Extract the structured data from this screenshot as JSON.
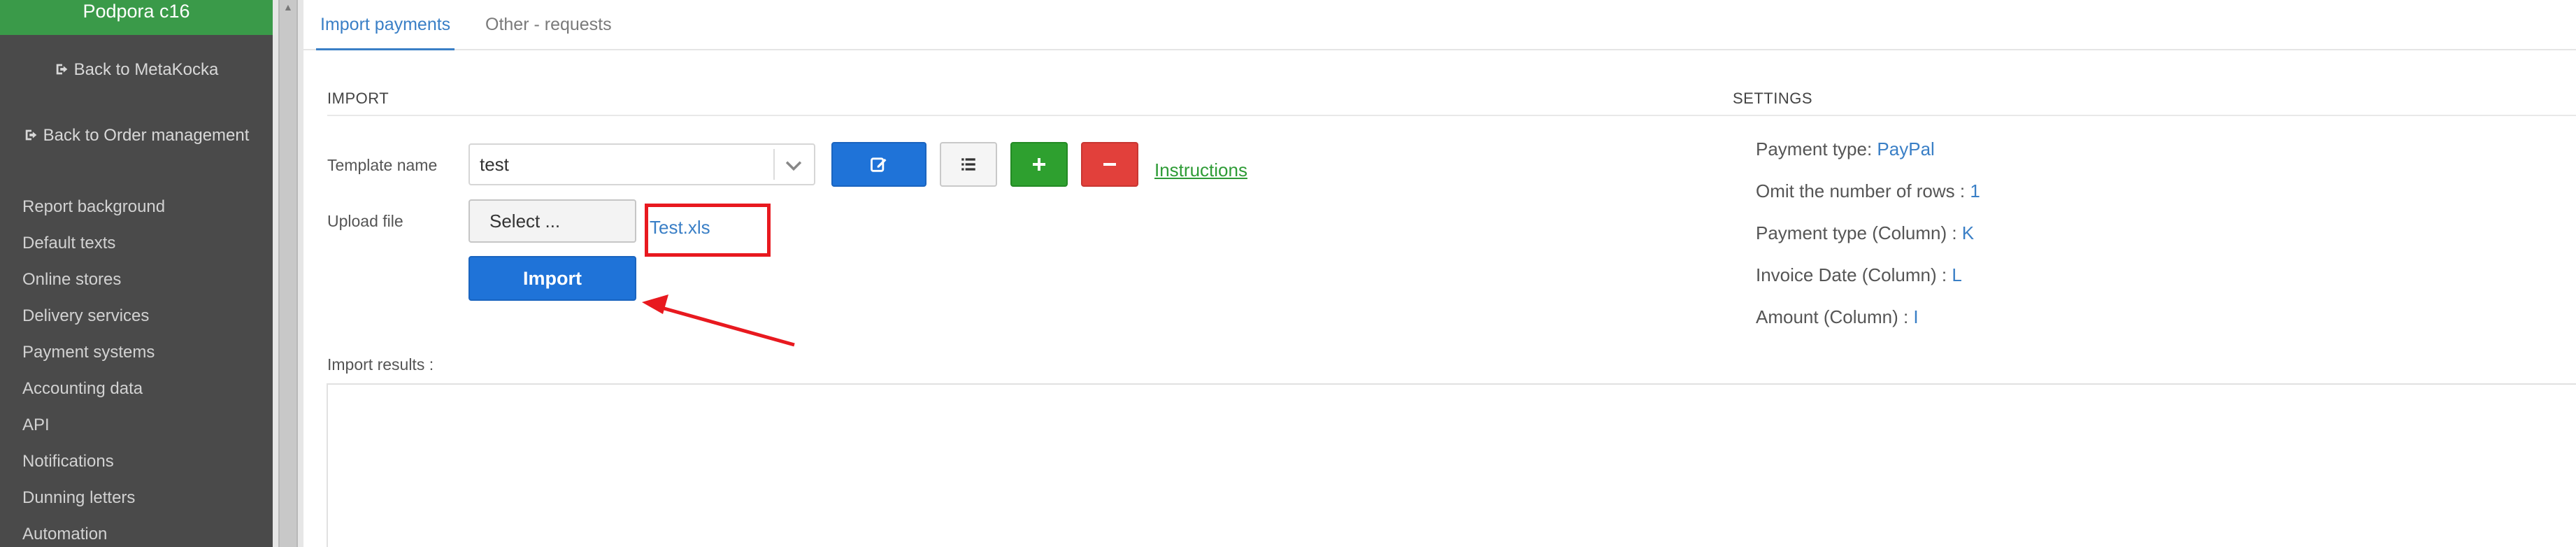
{
  "sidebar": {
    "header": "Podpora c16",
    "back_links": [
      {
        "label": "Back to MetaKocka",
        "icon": "sign-out-icon"
      },
      {
        "label": "Back to Order management",
        "icon": "sign-out-icon"
      }
    ],
    "items": [
      {
        "label": "Report background"
      },
      {
        "label": "Default texts"
      },
      {
        "label": "Online stores"
      },
      {
        "label": "Delivery services"
      },
      {
        "label": "Payment systems"
      },
      {
        "label": "Accounting data"
      },
      {
        "label": "API"
      },
      {
        "label": "Notifications"
      },
      {
        "label": "Dunning letters"
      },
      {
        "label": "Automation"
      }
    ]
  },
  "tabs": [
    {
      "label": "Import payments",
      "active": true
    },
    {
      "label": "Other - requests",
      "active": false
    }
  ],
  "import": {
    "title": "IMPORT",
    "template_label": "Template name",
    "template_value": "test",
    "buttons": {
      "edit": "edit-icon",
      "list": "list-icon",
      "add": "plus-icon",
      "remove": "minus-icon"
    },
    "instructions": "Instructions",
    "upload_label": "Upload file",
    "select_button": "Select ...",
    "file_name": "Test.xls",
    "import_button": "Import"
  },
  "settings": {
    "title": "SETTINGS",
    "items": [
      {
        "label": "Payment type: ",
        "value": "PayPal"
      },
      {
        "label": "Omit the number of rows : ",
        "value": "1"
      },
      {
        "label": "Payment type (Column) : ",
        "value": "K"
      },
      {
        "label": "Invoice Date (Column) : ",
        "value": "L"
      },
      {
        "label": "Amount (Column) : ",
        "value": "I"
      }
    ]
  },
  "results": {
    "label": "Import results :"
  },
  "colors": {
    "sidebar_bg": "#4a4a4a",
    "header_green": "#3a9a49",
    "primary_blue": "#1f73d8",
    "success_green": "#2ea02f",
    "danger_red": "#e2403b",
    "link_blue": "#3a7fc6",
    "annotation_red": "#e8191f"
  }
}
